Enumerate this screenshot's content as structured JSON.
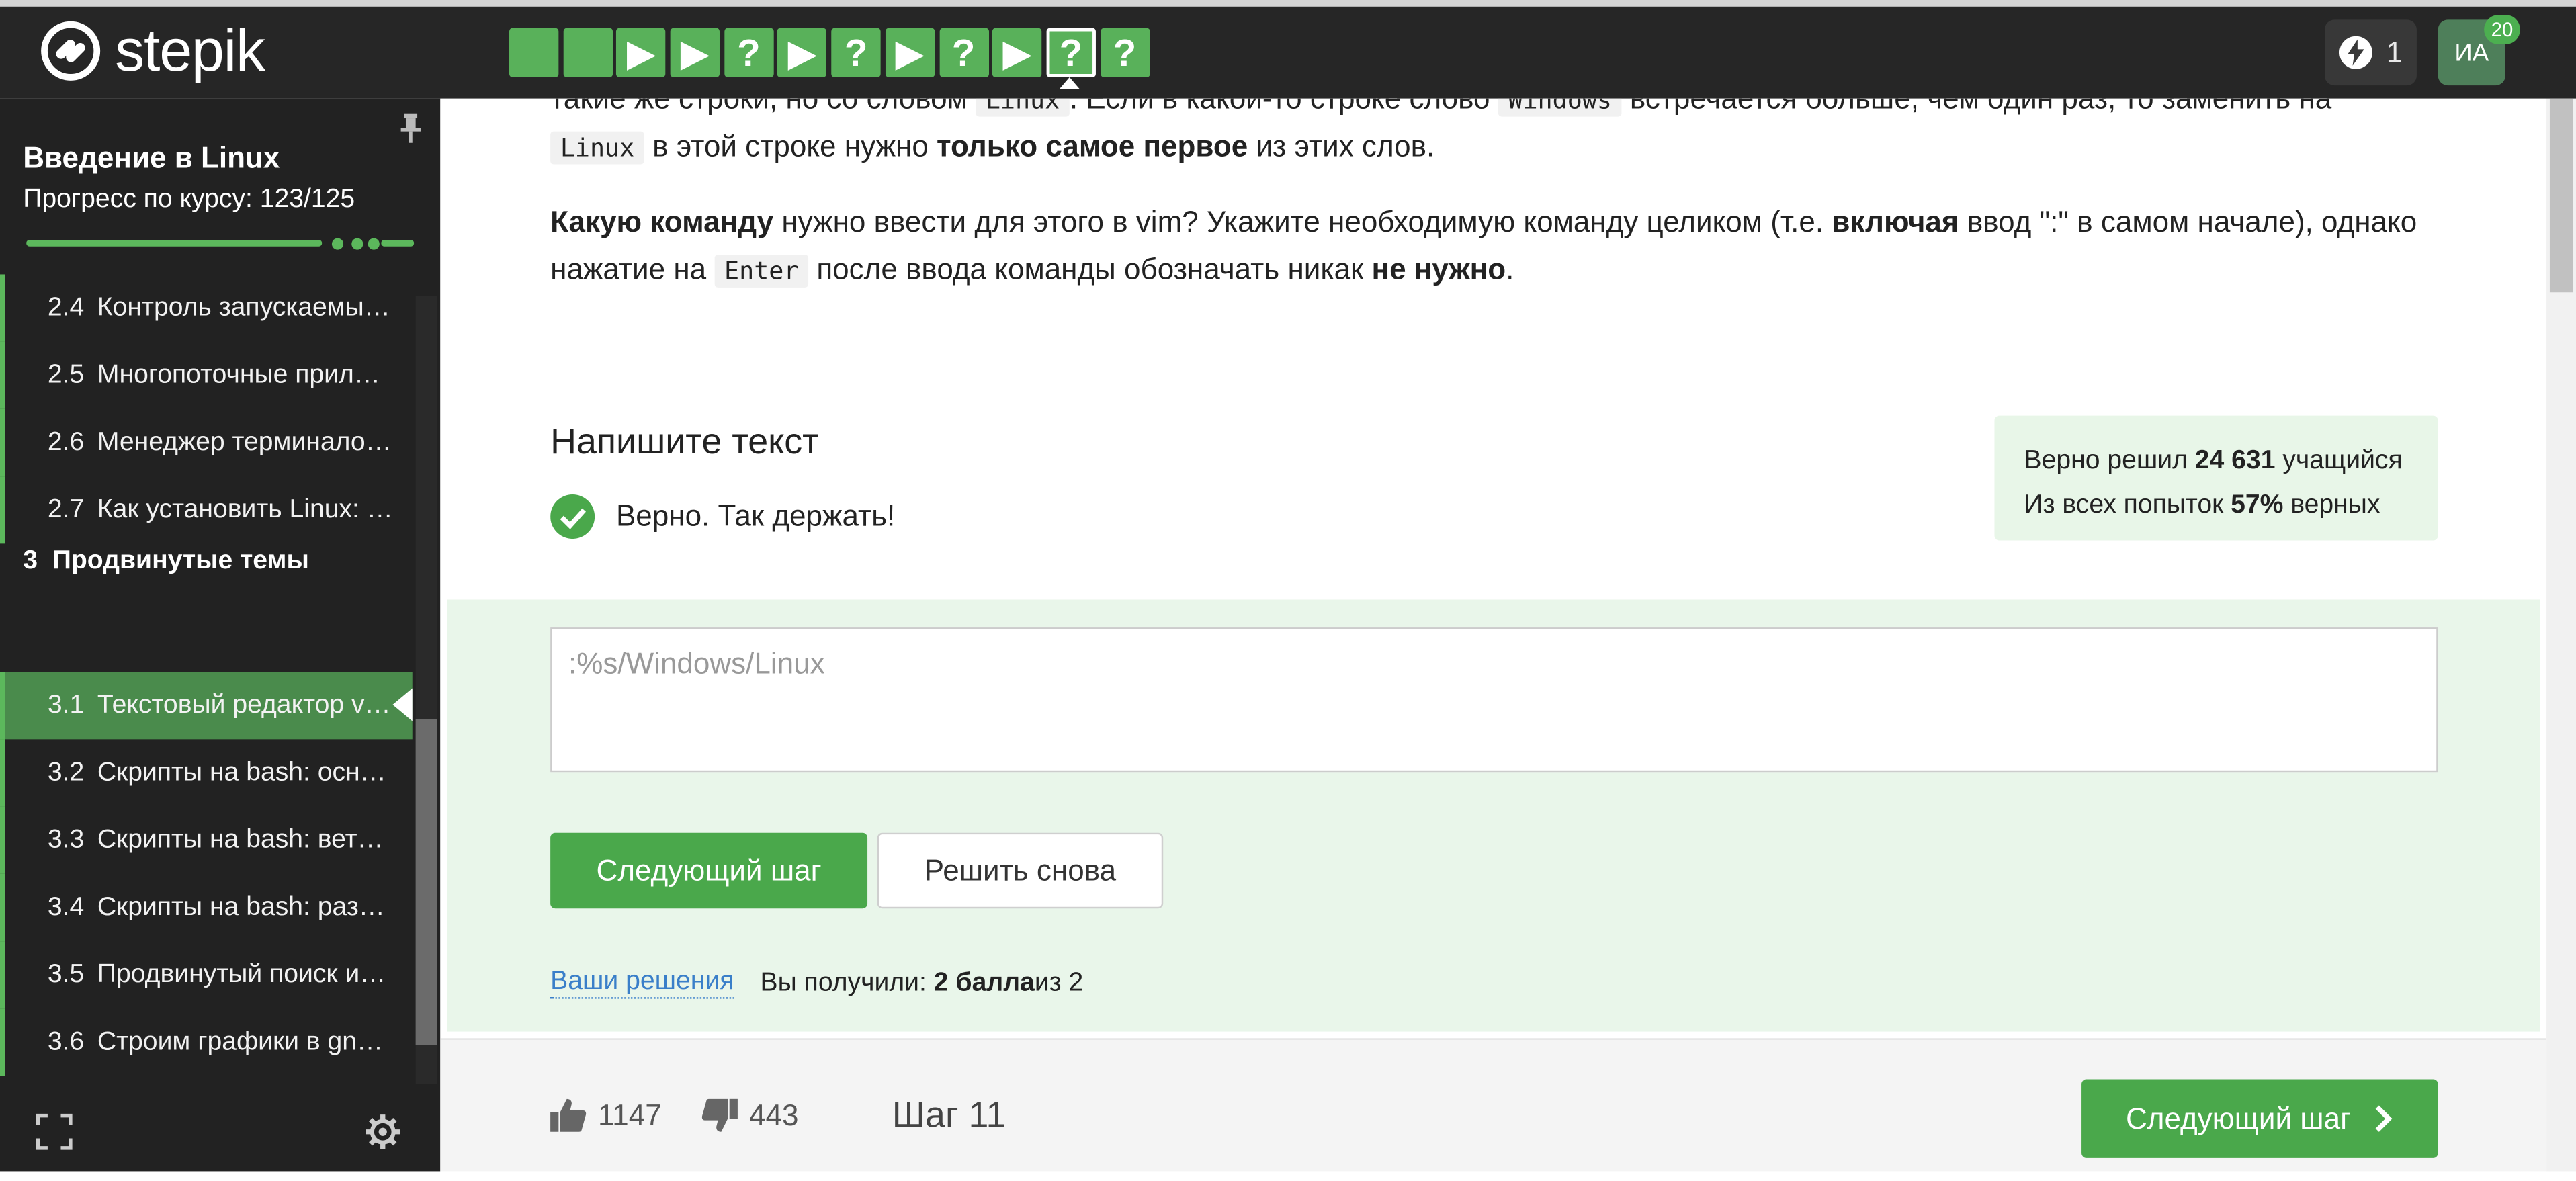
{
  "header": {
    "logo_text": "stepik",
    "steps": [
      {
        "kind": "done",
        "glyph": ""
      },
      {
        "kind": "done",
        "glyph": ""
      },
      {
        "kind": "video",
        "glyph": "▶"
      },
      {
        "kind": "video",
        "glyph": "▶"
      },
      {
        "kind": "quiz",
        "glyph": "?"
      },
      {
        "kind": "video",
        "glyph": "▶"
      },
      {
        "kind": "quiz",
        "glyph": "?"
      },
      {
        "kind": "video",
        "glyph": "▶"
      },
      {
        "kind": "quiz",
        "glyph": "?"
      },
      {
        "kind": "video",
        "glyph": "▶"
      },
      {
        "kind": "quiz-current",
        "glyph": "?"
      },
      {
        "kind": "quiz",
        "glyph": "?"
      }
    ],
    "energy_count": "1",
    "avatar_initials": "ИА",
    "notification_count": "20"
  },
  "sidebar": {
    "course_title": "Введение в Linux",
    "progress_label": "Прогресс по курсу:  123/125",
    "progress_fraction": 0.984,
    "lessons_top": [
      {
        "num": "2.4",
        "title": "Контроль запускаемы…"
      },
      {
        "num": "2.5",
        "title": "Многопоточные прил…"
      },
      {
        "num": "2.6",
        "title": "Менеджер терминало…"
      },
      {
        "num": "2.7",
        "title": "Как установить Linux: …"
      }
    ],
    "section": {
      "num": "3",
      "title": "Продвинутые темы"
    },
    "lessons_bottom": [
      {
        "num": "3.1",
        "title": "Текстовый редактор v…",
        "active": true
      },
      {
        "num": "3.2",
        "title": "Скрипты на bash: осн…"
      },
      {
        "num": "3.3",
        "title": "Скрипты на bash: вет…"
      },
      {
        "num": "3.4",
        "title": "Скрипты на bash: раз…"
      },
      {
        "num": "3.5",
        "title": "Продвинутый поиск и…"
      },
      {
        "num": "3.6",
        "title": "Строим графики в gn…"
      }
    ]
  },
  "content": {
    "para1_a": "такие же строки, но со словом ",
    "para1_code1": "Linux",
    "para1_b": ". Если в какой-то строке слово ",
    "para1_code2": "Windows",
    "para1_c": " встречается больше, чем один раз, то заменить на",
    "para2_code": "Linux",
    "para2_a": " в этой строке нужно ",
    "para2_bold": "только самое первое",
    "para2_b": " из этих слов.",
    "para3_bold1": "Какую команду",
    "para3_a": " нужно ввести для этого в vim? Укажите необходимую команду целиком (т.е. ",
    "para3_bold2": "включая",
    "para3_b": " ввод \":\" в самом начале), однако",
    "para4_a": "нажатие на ",
    "para4_code": "Enter",
    "para4_b": " после ввода команды обозначать никак ",
    "para4_bold": "не нужно",
    "para4_c": ".",
    "heading": "Напишите текст",
    "result_text": "Верно. Так держать!",
    "stats": {
      "solved_prefix": "Верно решил ",
      "solved_count": "24 631",
      "solved_suffix": " учащийся",
      "attempts_prefix": "Из всех попыток ",
      "attempts_percent": "57%",
      "attempts_suffix": " верных"
    },
    "answer_value": ":%s/Windows/Linux",
    "next_button": "Следующий шаг",
    "retry_button": "Решить снова",
    "solutions_link": "Ваши решения",
    "score_prefix": "Вы получили: ",
    "score_bold": "2 балла",
    "score_suffix": " из 2"
  },
  "footer": {
    "likes": "1147",
    "dislikes": "443",
    "step_label": "Шаг 11",
    "next_button": "Следующий шаг"
  },
  "colors": {
    "accent": "#4aa84b",
    "header_bg": "#262626",
    "sidebar_bg": "#222222",
    "answer_bg": "#e9f6ea"
  }
}
